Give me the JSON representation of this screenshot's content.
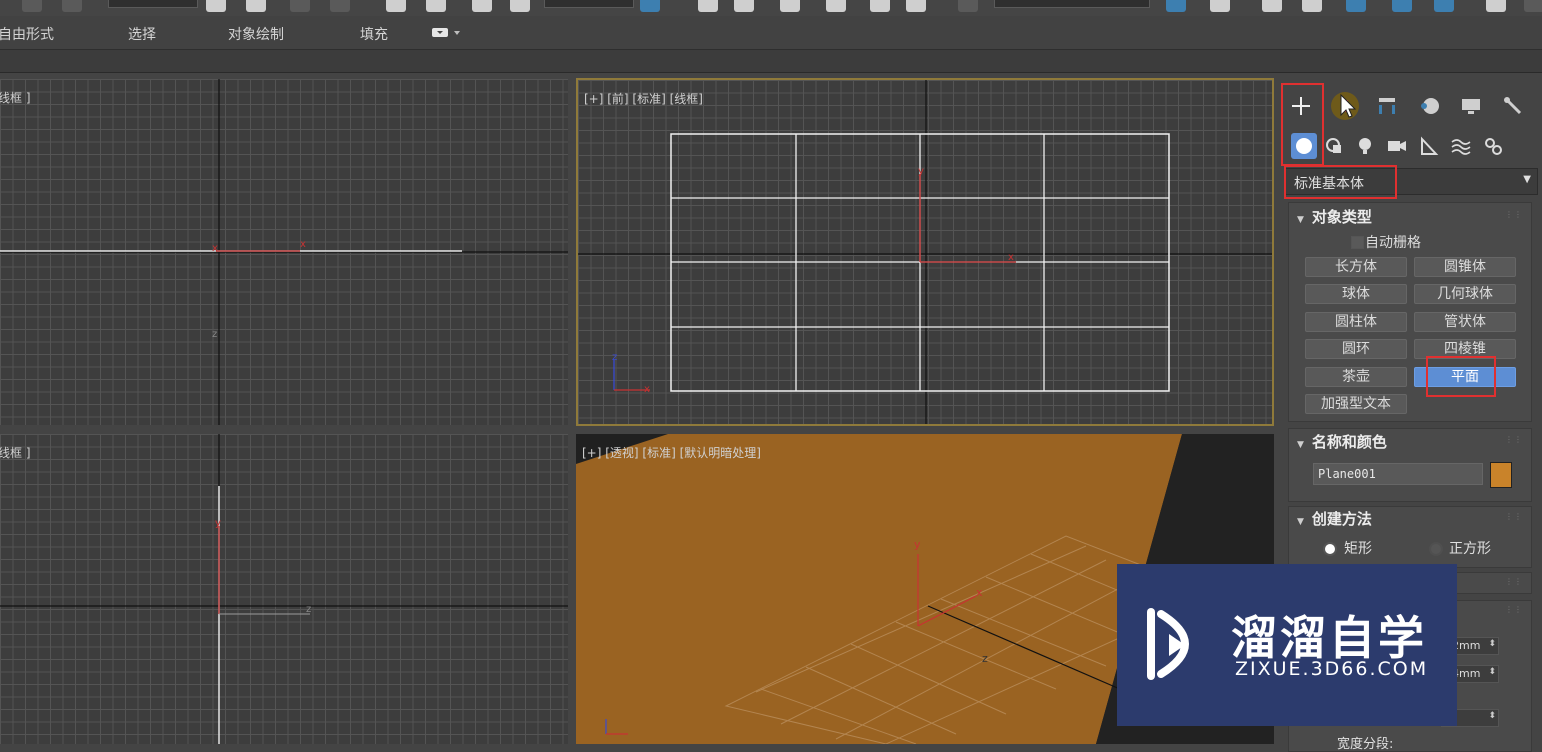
{
  "ribbon": {
    "tabs": [
      "自由形式",
      "选择",
      "对象绘制",
      "填充"
    ]
  },
  "viewports": {
    "top_left": {
      "label": "线框 ]"
    },
    "top_right": {
      "label": "[+] [前] [标准] [线框]"
    },
    "bottom_left": {
      "label": "线框 ]"
    },
    "bottom_right": {
      "label": "[+] [透视] [标准] [默认明暗处理]"
    }
  },
  "axes": {
    "x": "x",
    "y": "y",
    "z": "z"
  },
  "command_panel": {
    "category_dropdown": "标准基本体",
    "object_type": {
      "title": "对象类型",
      "autogrid_label": "自动栅格",
      "buttons": [
        "长方体",
        "圆锥体",
        "球体",
        "几何球体",
        "圆柱体",
        "管状体",
        "圆环",
        "四棱锥",
        "茶壶",
        "平面",
        "加强型文本"
      ],
      "active_button": "平面"
    },
    "name_color": {
      "title": "名称和颜色",
      "name_value": "Plane001",
      "color": "#c9832a"
    },
    "creation_method": {
      "title": "创建方法",
      "options": [
        "矩形",
        "正方形"
      ],
      "selected": "矩形"
    },
    "params": {
      "value_1": "2mm",
      "value_2": "4mm",
      "width_segs_label": "宽度分段:"
    }
  },
  "watermark": {
    "brand": "溜溜自学",
    "url": "ZIXUE.3D66.COM"
  },
  "colors": {
    "highlight": "#e03030",
    "active_button": "#5d8ed4",
    "plane_orange": "#9a6322",
    "viewport_active_border": "#8f7a3a"
  }
}
